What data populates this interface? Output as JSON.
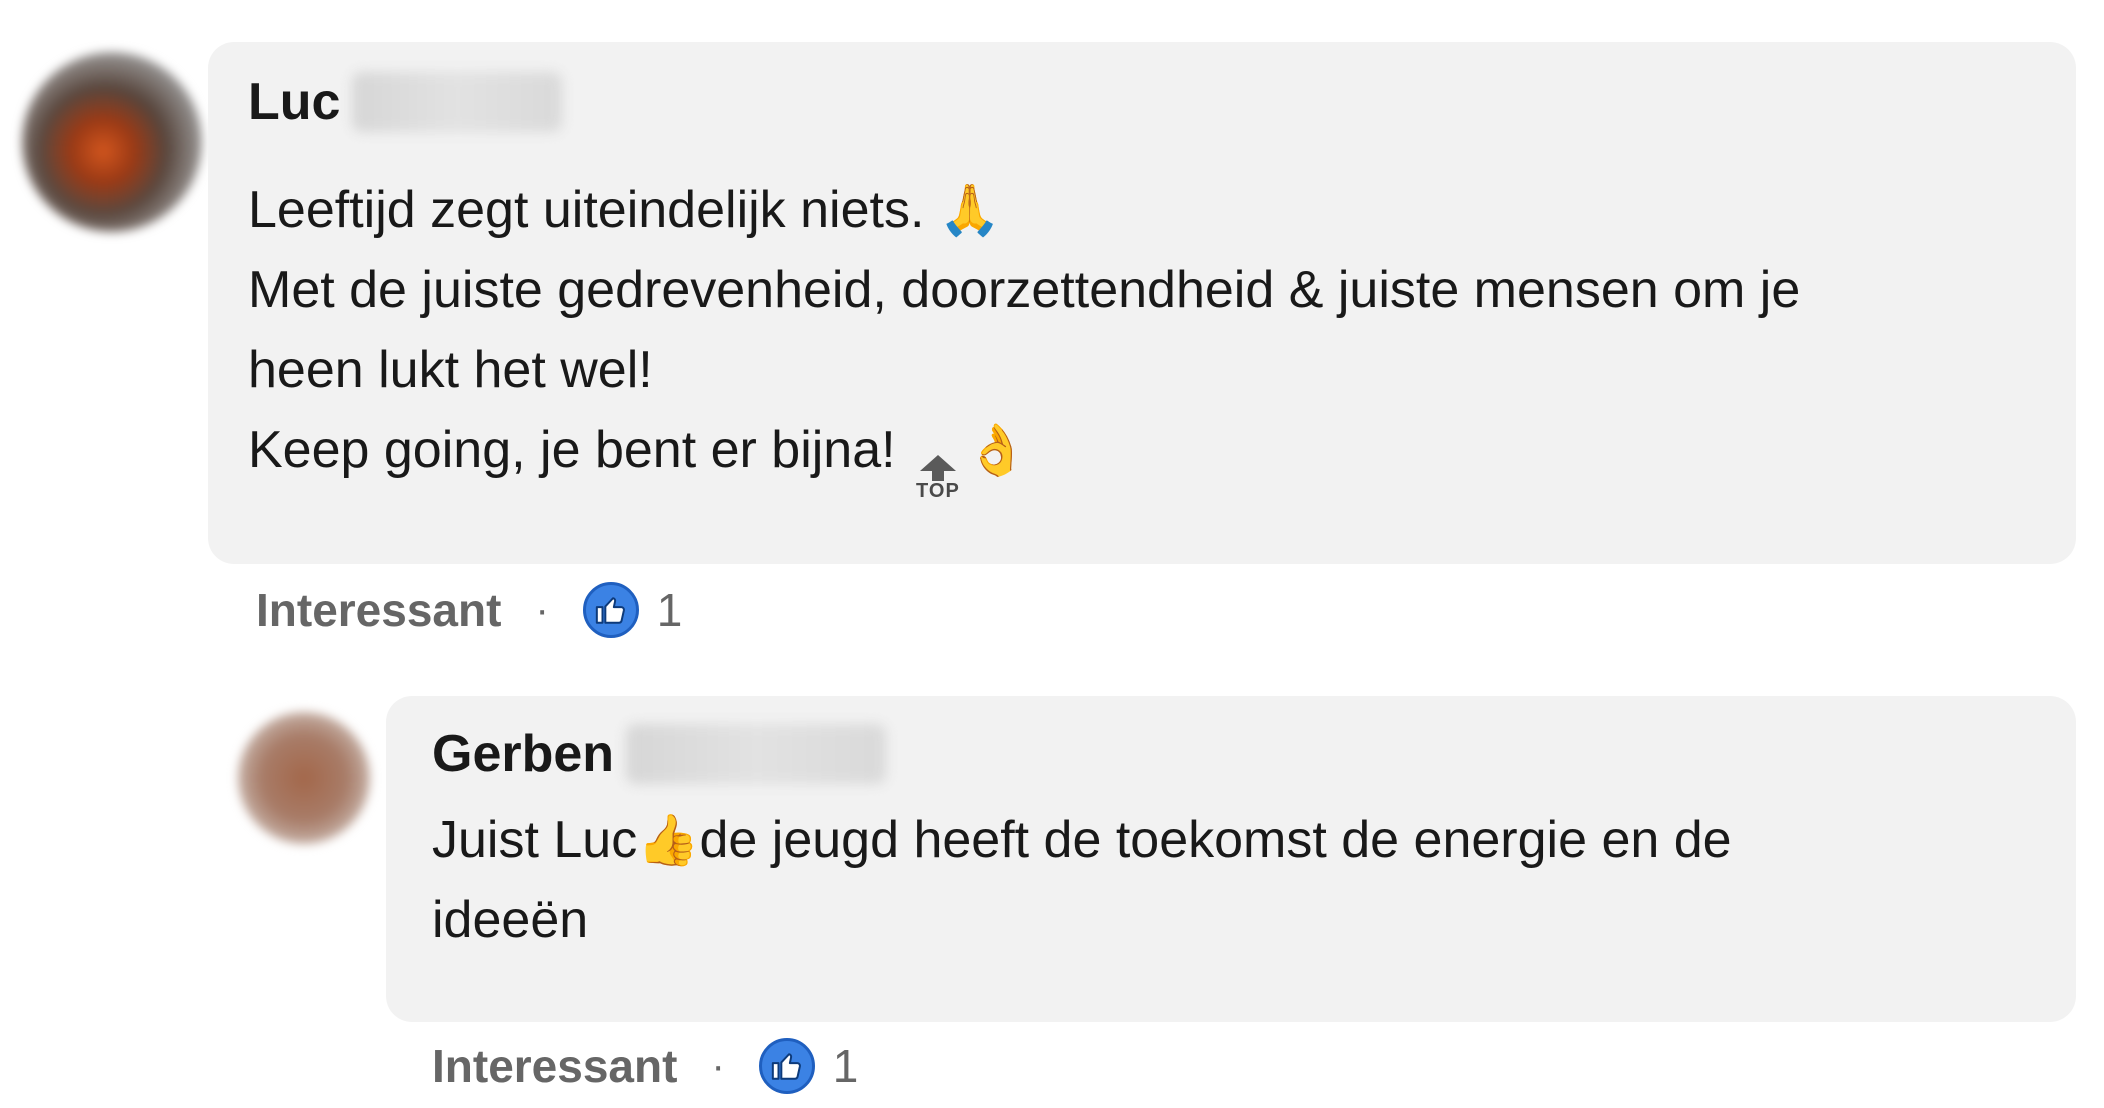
{
  "comments": [
    {
      "author_first_name": "Luc",
      "text_line_1": "Leeftijd zegt uiteindelijk niets. ",
      "emoji_1": "🙏",
      "text_line_2": "Met de juiste gedrevenheid, doorzettendheid & juiste mensen om je",
      "text_line_3": "heen lukt het wel!",
      "text_line_4": "Keep going, je bent er bijna! ",
      "top_label": "TOP",
      "emoji_2": "👌",
      "action_label": "Interessant",
      "separator": "·",
      "reaction_count": "1"
    },
    {
      "author_first_name": "Gerben",
      "text_part_1": "Juist Luc",
      "emoji_1": "👍",
      "text_part_2": "de jeugd heeft de toekomst de energie en de",
      "text_line_2": "ideeën",
      "action_label": "Interessant",
      "separator": "·",
      "reaction_count": "1"
    }
  ],
  "colors": {
    "bubble_bg": "#f2f2f2",
    "action_text": "#666666",
    "like_blue": "#3b82e4"
  }
}
